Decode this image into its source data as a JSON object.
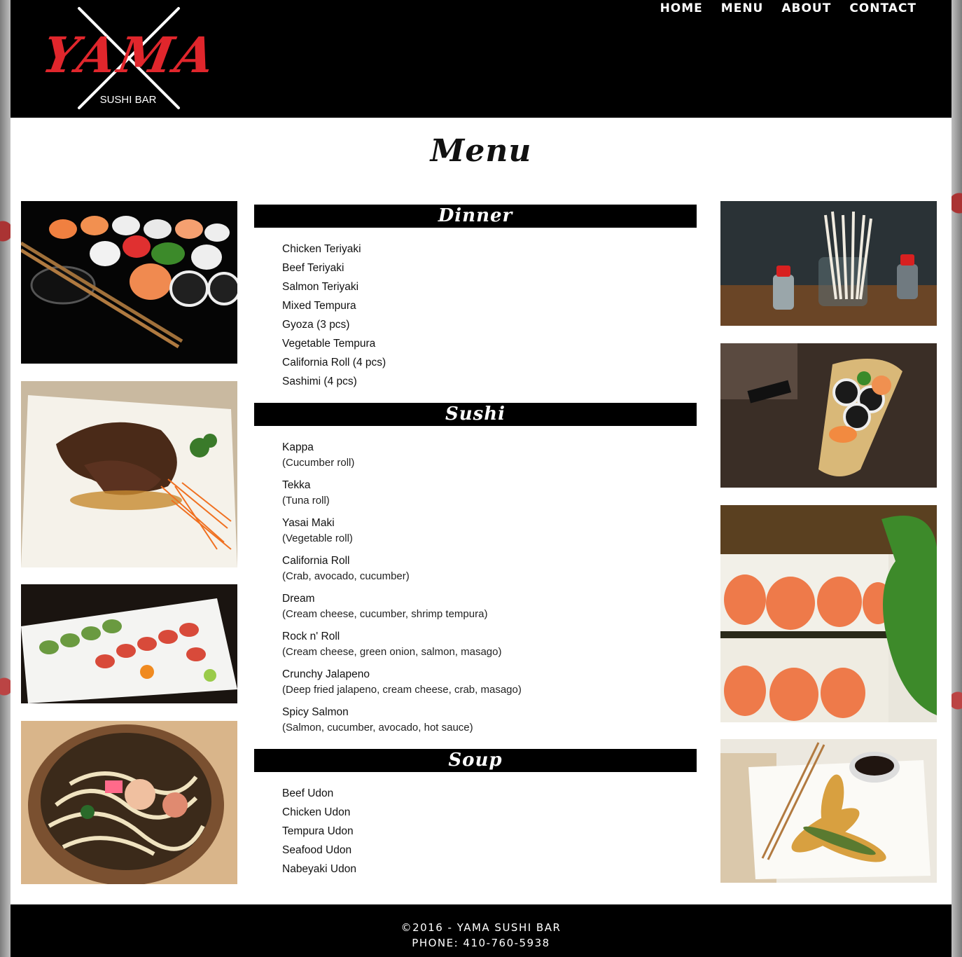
{
  "brand": {
    "logo_text": "YAMA",
    "logo_subtext": "SUSHI BAR",
    "accent_color": "#e0262c"
  },
  "nav": {
    "items": [
      {
        "label": "HOME"
      },
      {
        "label": "MENU"
      },
      {
        "label": "ABOUT"
      },
      {
        "label": "CONTACT"
      }
    ]
  },
  "page": {
    "title": "Menu"
  },
  "menu": {
    "dinner": {
      "heading": "Dinner",
      "items": [
        "Chicken Teriyaki",
        "Beef Teriyaki",
        "Salmon Teriyaki",
        "Mixed Tempura",
        "Gyoza (3 pcs)",
        "Vegetable Tempura",
        "California Roll (4 pcs)",
        "Sashimi (4 pcs)"
      ]
    },
    "sushi": {
      "heading": "Sushi",
      "items": [
        {
          "name": "Kappa",
          "desc": "(Cucumber roll)"
        },
        {
          "name": "Tekka",
          "desc": "(Tuna roll)"
        },
        {
          "name": "Yasai Maki",
          "desc": "(Vegetable roll)"
        },
        {
          "name": "California Roll",
          "desc": "(Crab, avocado, cucumber)"
        },
        {
          "name": "Dream",
          "desc": "(Cream cheese, cucumber, shrimp tempura)"
        },
        {
          "name": "Rock n' Roll",
          "desc": "(Cream cheese, green onion, salmon, masago)"
        },
        {
          "name": "Crunchy Jalapeno",
          "desc": "(Deep fried jalapeno, cream cheese, crab, masago)"
        },
        {
          "name": "Spicy Salmon",
          "desc": "(Salmon, cucumber, avocado, hot sauce)"
        }
      ]
    },
    "soup": {
      "heading": "Soup",
      "items": [
        "Beef Udon",
        "Chicken Udon",
        "Tempura Udon",
        "Seafood Udon",
        "Nabeyaki Udon"
      ]
    }
  },
  "photos": {
    "left": [
      "sushi-platter-photo",
      "beef-teriyaki-photo",
      "sushi-rolls-plate-photo",
      "udon-bowl-photo"
    ],
    "right": [
      "chopsticks-soy-photo",
      "sushi-boat-photo",
      "roll-closeup-photo",
      "tempura-photo"
    ]
  },
  "footer": {
    "copyright": "©2016 - YAMA SUSHI BAR",
    "phone": "PHONE: 410-760-5938"
  }
}
